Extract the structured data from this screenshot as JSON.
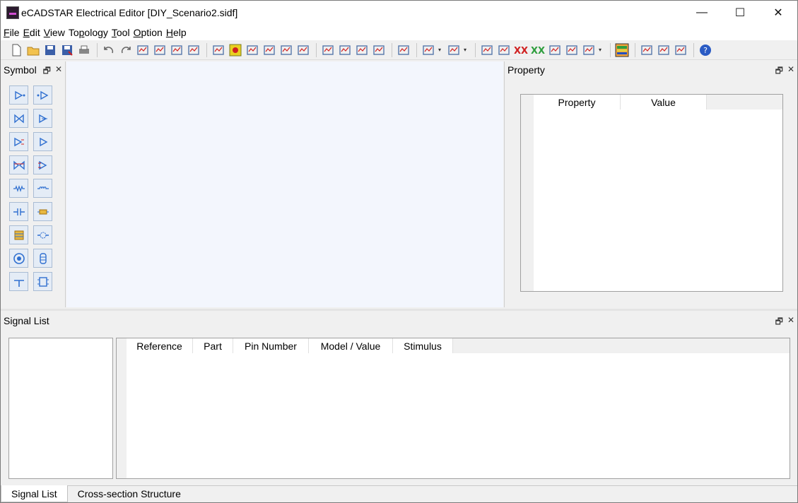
{
  "window": {
    "title": "eCADSTAR Electrical Editor [DIY_Scenario2.sidf]",
    "minimize_glyph": "—",
    "maximize_glyph": "☐",
    "close_glyph": "✕"
  },
  "menu": [
    {
      "mnemonic": "F",
      "rest": "ile"
    },
    {
      "mnemonic": "E",
      "rest": "dit"
    },
    {
      "mnemonic": "V",
      "rest": "iew"
    },
    {
      "pre": "To",
      "mnemonic": "p",
      "rest": "ology"
    },
    {
      "mnemonic": "T",
      "rest": "ool"
    },
    {
      "mnemonic": "O",
      "rest": "ption"
    },
    {
      "mnemonic": "H",
      "rest": "elp"
    }
  ],
  "toolbar_icons": [
    "new-file-icon",
    "open-folder-icon",
    "save-icon",
    "save-as-icon",
    "print-icon",
    "undo-icon",
    "redo-icon",
    "cut-icon",
    "copy-icon",
    "paste-icon",
    "clipboard-icon",
    "zoom-fit-icon",
    "zoom-all-icon",
    "zoom-area-icon",
    "zoom-in-icon",
    "zoom-out-icon",
    "grid-icon",
    "net-icon",
    "tree-icon",
    "bus-icon",
    "delete-net-icon",
    "component-icon",
    "waveform-icon",
    "eye-diagram-icon",
    "spectrum-icon",
    "peak-icon",
    "crosstalk-icon",
    "crosstalk-multi-icon",
    "report-icon",
    "report2-icon",
    "spice-icon",
    "stackup-icon",
    "settings-icon",
    "cd-icon",
    "probe-icon",
    "help-icon"
  ],
  "symbol_panel": {
    "title": "Symbol",
    "icons": [
      "driver-icon",
      "receiver-icon",
      "bidirectional-icon",
      "tristate-icon",
      "differential-driver-icon",
      "differential-receiver-icon",
      "differential-bidir-icon",
      "differential-tristate-icon",
      "resistor-icon",
      "inductor-icon",
      "capacitor-icon",
      "fuse-icon",
      "connector-icon",
      "via-icon",
      "target-icon",
      "coil-icon",
      "ground-icon",
      "package-icon"
    ]
  },
  "property_panel": {
    "title": "Property",
    "columns": [
      "Property",
      "Value"
    ]
  },
  "signal_list": {
    "title": "Signal List",
    "columns": [
      "Reference",
      "Part",
      "Pin Number",
      "Model / Value",
      "Stimulus"
    ]
  },
  "bottom_tabs": [
    {
      "label": "Signal List",
      "active": true
    },
    {
      "label": "Cross-section Structure",
      "active": false
    }
  ],
  "colors": {
    "canvas_bg": "#f3f6fd",
    "symbol_bg": "#e4ecf6",
    "symbol_blue": "#2f6fd0",
    "accent_red": "#d02020"
  }
}
